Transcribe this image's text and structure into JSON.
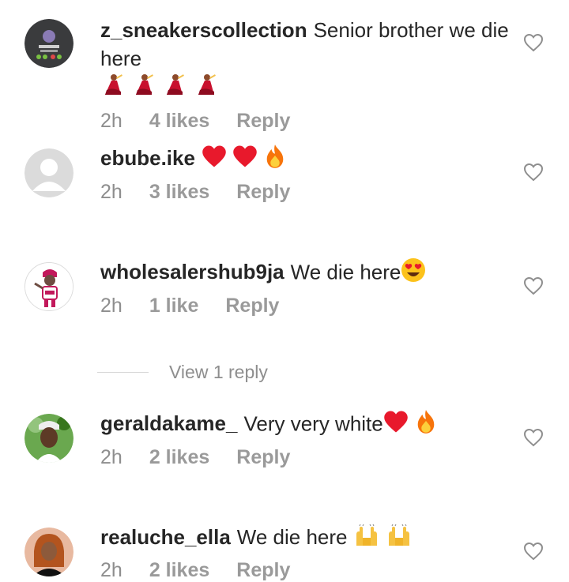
{
  "comments": [
    {
      "username": "z_sneakerscollection",
      "text": "Senior brother we die here",
      "emojis": [
        "dancer-emoji",
        "dancer-emoji",
        "dancer-emoji",
        "dancer-emoji"
      ],
      "time": "2h",
      "likes": "4 likes",
      "reply": "Reply"
    },
    {
      "username": "ebube.ike",
      "text": "",
      "emojis": [
        "red-heart-emoji",
        "red-heart-emoji",
        "fire-emoji"
      ],
      "time": "2h",
      "likes": "3 likes",
      "reply": "Reply"
    },
    {
      "username": "wholesalershub9ja",
      "text": "We die here",
      "emojis": [
        "heart-eyes-emoji"
      ],
      "time": "2h",
      "likes": "1 like",
      "reply": "Reply"
    },
    {
      "username": "geraldakame_",
      "text": "Very very white",
      "emojis": [
        "red-heart-emoji",
        "fire-emoji"
      ],
      "time": "2h",
      "likes": "2 likes",
      "reply": "Reply"
    },
    {
      "username": "realuche_ella",
      "text": "We die here",
      "emojis": [
        "raising-hands-emoji",
        "raising-hands-emoji"
      ],
      "time": "2h",
      "likes": "2 likes",
      "reply": "Reply"
    }
  ],
  "view_replies": {
    "label": "View 1 reply"
  },
  "colors": {
    "text": "#262626",
    "meta": "#8e8e8e",
    "heart_emoji": "#e8192c",
    "fire_emoji": "#f7740b"
  }
}
